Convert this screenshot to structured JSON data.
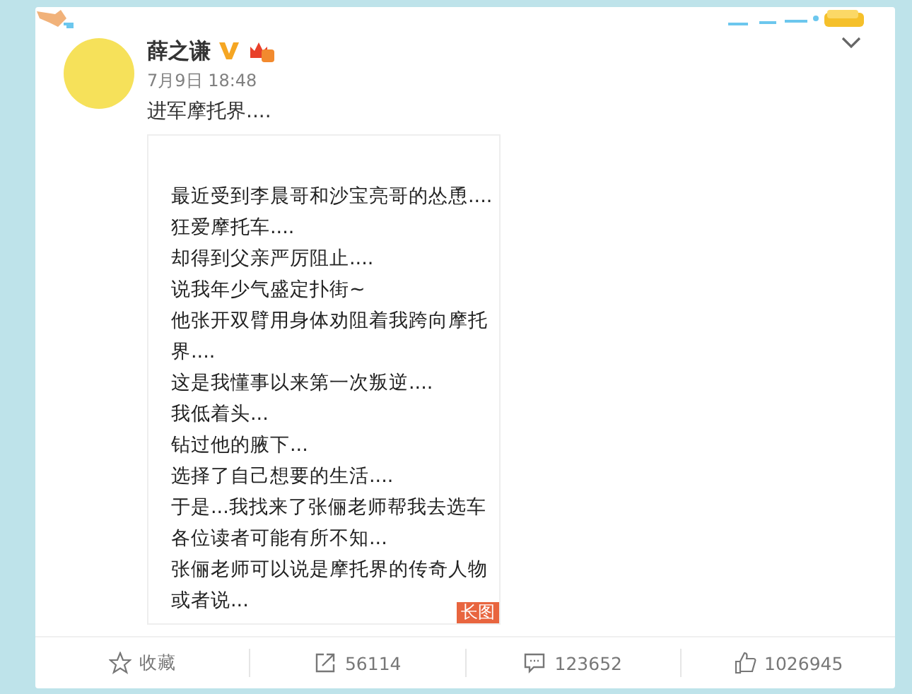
{
  "post": {
    "author": "薛之谦",
    "verified": true,
    "time": "7月9日 18:48",
    "text": "进军摩托界....",
    "image": {
      "badge": "长图",
      "lines": [
        "最近受到李晨哥和沙宝亮哥的怂恿....",
        "狂爱摩托车....",
        "却得到父亲严厉阻止....",
        "说我年少气盛定扑街~",
        "他张开双臂用身体劝阻着我跨向摩托",
        "界....",
        "这是我懂事以来第一次叛逆....",
        "我低着头...",
        "钻过他的腋下...",
        "选择了自己想要的生活....",
        "于是...我找来了张俪老师帮我去选车",
        "各位读者可能有所不知...",
        "张俪老师可以说是摩托界的传奇人物",
        "或者说..."
      ]
    }
  },
  "actions": [
    {
      "kind": "favorite",
      "label": "收藏"
    },
    {
      "kind": "repost",
      "label": "56114"
    },
    {
      "kind": "comment",
      "label": "123652"
    },
    {
      "kind": "like",
      "label": "1026945"
    }
  ]
}
